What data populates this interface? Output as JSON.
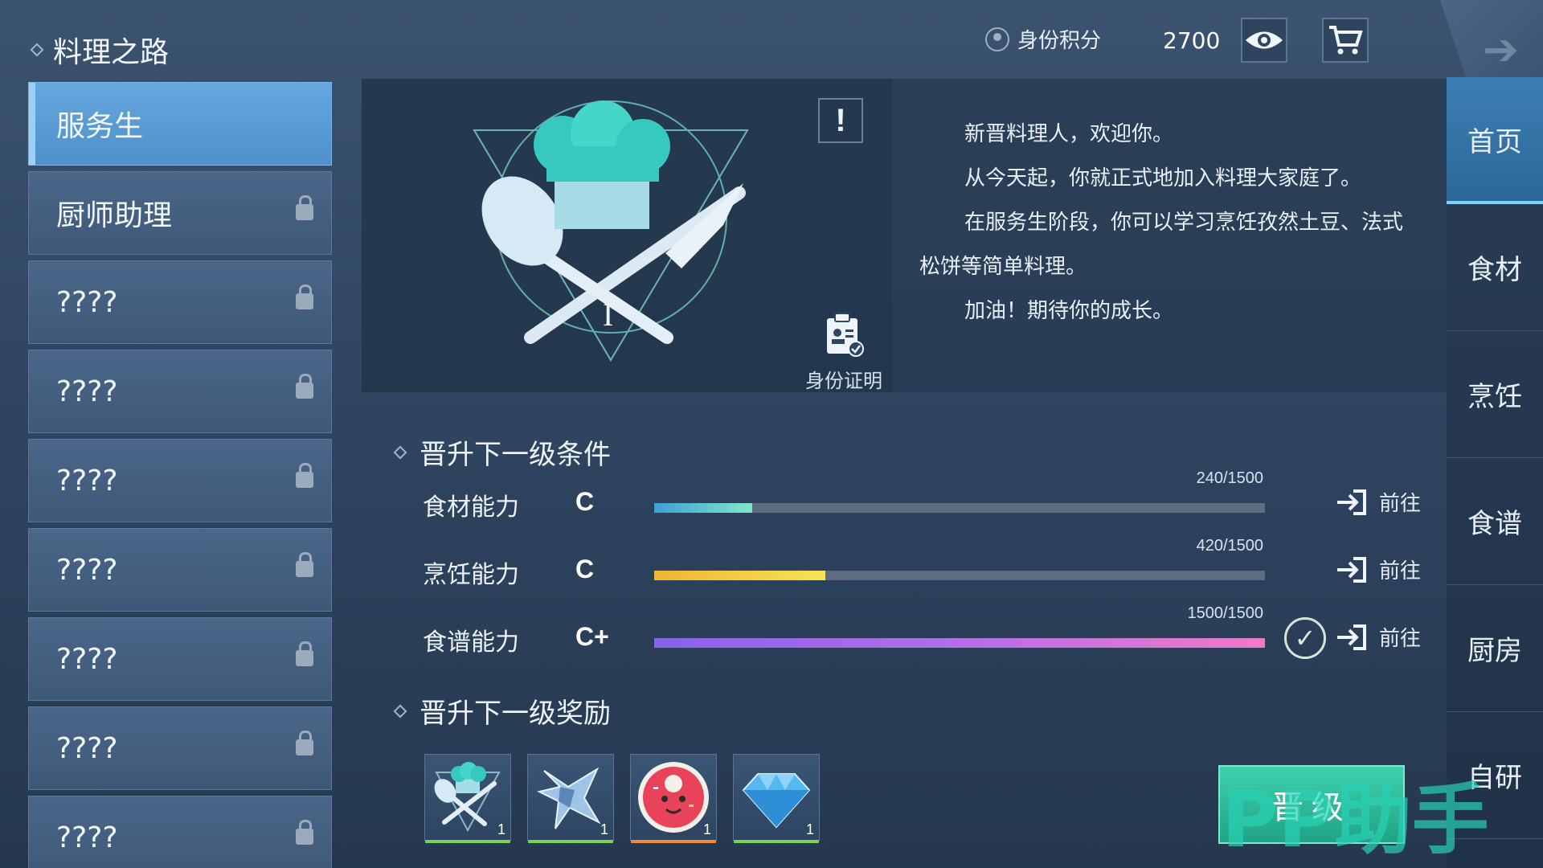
{
  "header": {
    "title": "料理之路",
    "score_label": "身份积分",
    "score_value": "2700"
  },
  "sidebar": {
    "items": [
      {
        "label": "服务生",
        "locked": false,
        "active": true
      },
      {
        "label": "厨师助理",
        "locked": true,
        "active": false
      },
      {
        "label": "????",
        "locked": true,
        "active": false
      },
      {
        "label": "????",
        "locked": true,
        "active": false
      },
      {
        "label": "????",
        "locked": true,
        "active": false
      },
      {
        "label": "????",
        "locked": true,
        "active": false
      },
      {
        "label": "????",
        "locked": true,
        "active": false
      },
      {
        "label": "????",
        "locked": true,
        "active": false
      },
      {
        "label": "????",
        "locked": true,
        "active": false
      }
    ]
  },
  "profile": {
    "alert_label": "!",
    "rank_mark": "I",
    "id_proof_label": "身份证明",
    "description": [
      "新晋料理人，欢迎你。",
      "从今天起，你就正式地加入料理大家庭了。",
      "在服务生阶段，你可以学习烹饪孜然土豆、法式松饼等简单料理。",
      "加油！期待你的成长。"
    ]
  },
  "requirements": {
    "title": "晋升下一级条件",
    "go_label": "前往",
    "rows": [
      {
        "name": "食材能力",
        "grade": "C",
        "value_text": "240/1500",
        "progress": 0.16,
        "colors": [
          "#3f9fd8",
          "#7fe8c8"
        ],
        "complete": false
      },
      {
        "name": "烹饪能力",
        "grade": "C",
        "value_text": "420/1500",
        "progress": 0.28,
        "colors": [
          "#f2b431",
          "#f5e35a"
        ],
        "complete": false
      },
      {
        "name": "食谱能力",
        "grade": "C+",
        "value_text": "1500/1500",
        "progress": 1.0,
        "colors": [
          "#8a63e8",
          "#b36ee8",
          "#f07ac8"
        ],
        "complete": true
      }
    ]
  },
  "rewards": {
    "title": "晋升下一级奖励",
    "items": [
      {
        "icon": "chef-emblem-icon",
        "count": "1",
        "bar_color": "#7ccf5a"
      },
      {
        "icon": "crystal-blade-icon",
        "count": "1",
        "bar_color": "#7ccf5a"
      },
      {
        "icon": "donut-icon",
        "count": "1",
        "bar_color": "#f08a3a"
      },
      {
        "icon": "diamond-icon",
        "count": "1",
        "bar_color": "#7ccf5a"
      }
    ]
  },
  "right_nav": {
    "tabs": [
      {
        "label": "首页",
        "active": true
      },
      {
        "label": "食材",
        "active": false
      },
      {
        "label": "烹饪",
        "active": false
      },
      {
        "label": "食谱",
        "active": false
      },
      {
        "label": "厨房",
        "active": false
      },
      {
        "label": "自研",
        "active": false
      }
    ]
  },
  "promote_button": {
    "label": "晋级"
  },
  "watermark": {
    "text": "PP助手"
  },
  "colors": {
    "accent": "#5fa4db",
    "promote": "#2fbf9c"
  }
}
